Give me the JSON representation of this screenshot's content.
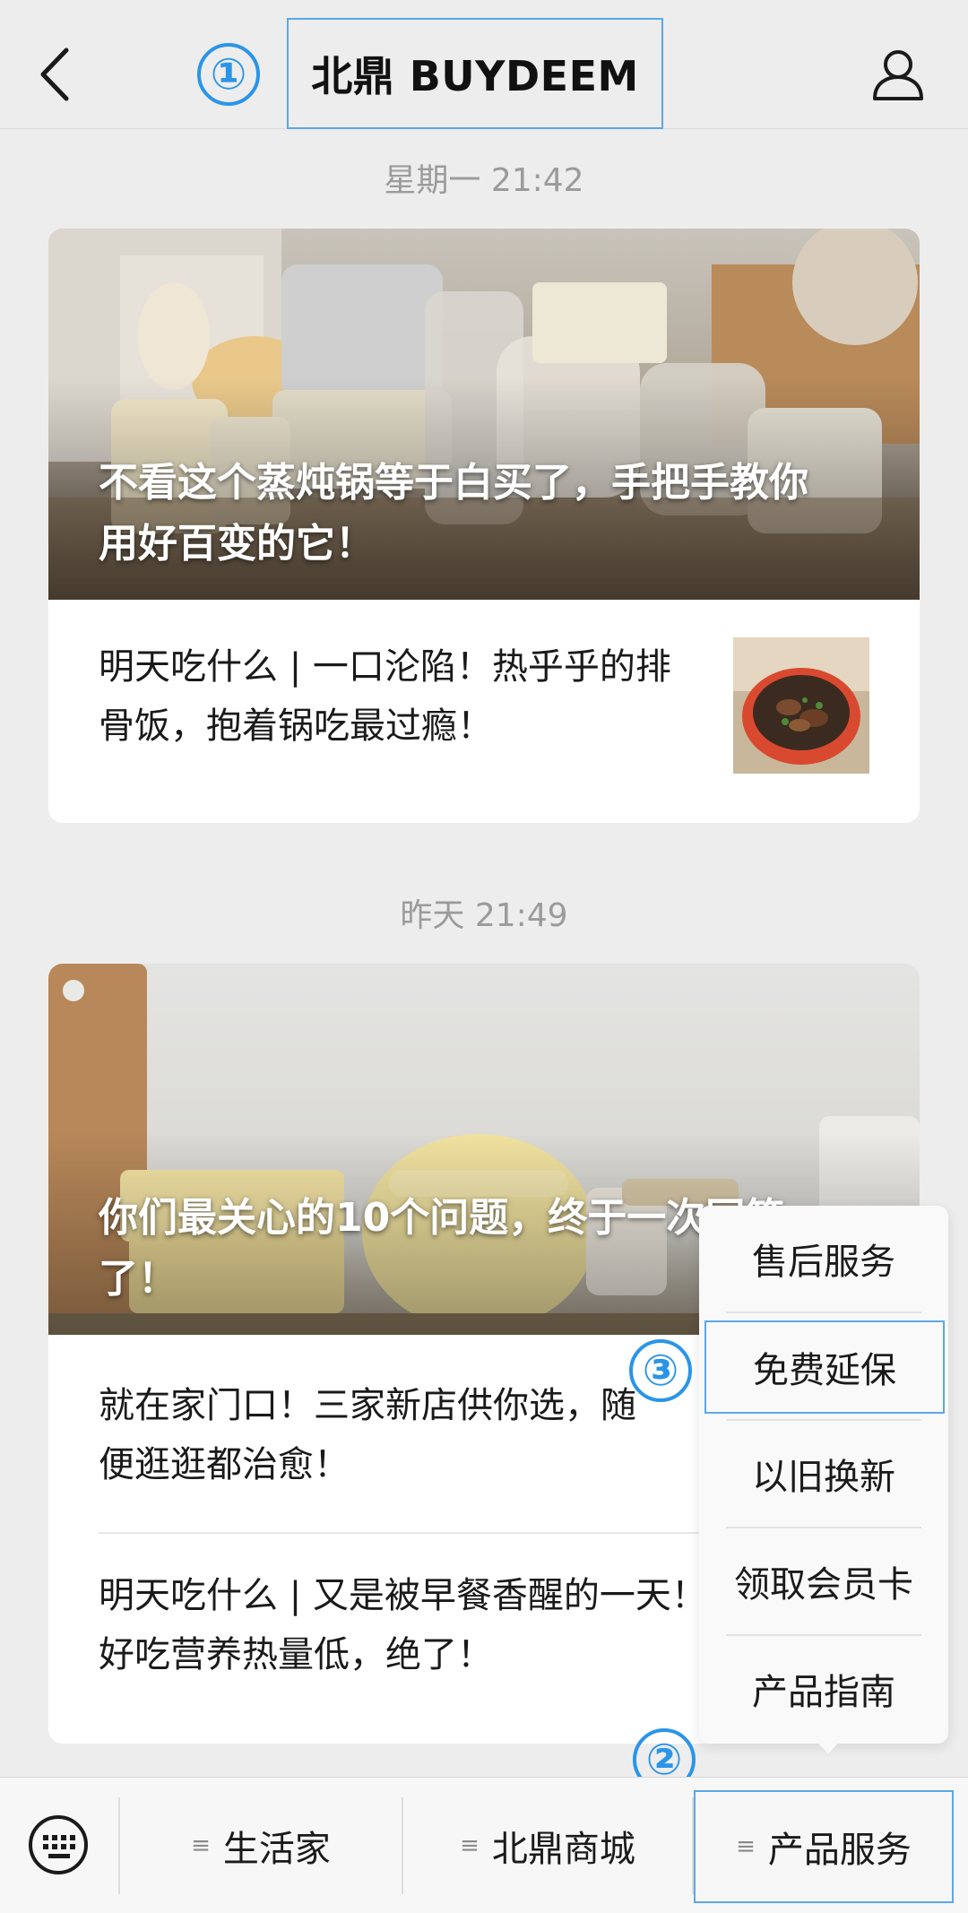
{
  "header": {
    "title": "北鼎 BUYDEEM",
    "back_icon": "chevron-left-icon",
    "profile_icon": "user-icon"
  },
  "markers": {
    "one": "①",
    "two": "②",
    "three": "③"
  },
  "colors": {
    "marker": "#2a95e8",
    "highlight_border": "#5aa8e8",
    "background": "#ededed"
  },
  "messages": [
    {
      "time": "星期一 21:42",
      "cover_title": "不看这个蒸炖锅等于白买了，手把手教你用好百变的它！",
      "items": [
        {
          "title": "明天吃什么 | 一口沦陷！热乎乎的排骨饭，抱着锅吃最过瘾！"
        }
      ]
    },
    {
      "time": "昨天 21:49",
      "cover_title": "你们最关心的10个问题，终于一次回答了！",
      "items": [
        {
          "title": "就在家门口！三家新店供你选，随便逛逛都治愈！"
        },
        {
          "title": "明天吃什么 | 又是被早餐香醒的一天！好吃营养热量低，绝了！"
        }
      ]
    }
  ],
  "submenu": {
    "items": [
      "售后服务",
      "免费延保",
      "以旧换新",
      "领取会员卡",
      "产品指南"
    ]
  },
  "bottom_menu": {
    "keyboard_icon": "keyboard-icon",
    "tabs": [
      "生活家",
      "北鼎商城",
      "产品服务"
    ]
  }
}
